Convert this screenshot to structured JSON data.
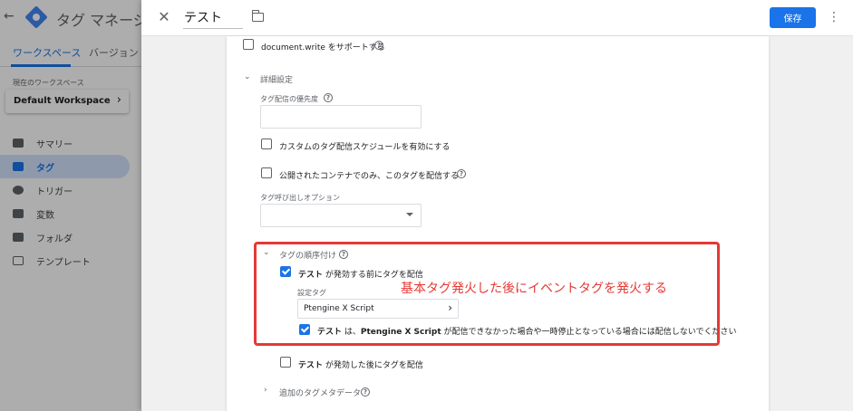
{
  "background": {
    "app_title": "タグ マネージャー",
    "tabs": [
      {
        "label": "ワークスペース",
        "active": true
      },
      {
        "label": "バージョン",
        "active": false
      }
    ],
    "workspace_label": "現在のワークスペース",
    "workspace_name": "Default Workspace",
    "nav_items": [
      {
        "label": "サマリー",
        "icon": "summary-icon",
        "active": false
      },
      {
        "label": "タグ",
        "icon": "tag-icon",
        "active": true
      },
      {
        "label": "トリガー",
        "icon": "trigger-icon",
        "active": false
      },
      {
        "label": "変数",
        "icon": "variable-icon",
        "active": false
      },
      {
        "label": "フォルダ",
        "icon": "folder-icon",
        "active": false
      },
      {
        "label": "テンプレート",
        "icon": "template-icon",
        "active": false
      }
    ]
  },
  "header": {
    "tag_name": "テスト",
    "save_label": "保存"
  },
  "settings": {
    "document_write_label": "document.write をサポートする",
    "advanced_title": "詳細設定",
    "priority_label": "タグ配信の優先度",
    "priority_value": "",
    "schedule_label": "カスタムのタグ配信スケジュールを有効にする",
    "publish_only_label": "公開されたコンテナでのみ、このタグを配信する",
    "firing_option_label": "タグ呼び出しオプション",
    "firing_option_value": "",
    "sequencing": {
      "title": "タグの順序付け",
      "before": {
        "checked": true,
        "tag": "テスト",
        "text": " が発効する前にタグを配信"
      },
      "setup_tag_label": "設定タグ",
      "setup_tag_value": "Ptengine X Script",
      "dont_fire": {
        "checked": true,
        "tag": "テスト",
        "mid": " は、",
        "setup": "Ptengine X Script",
        "text": " が配信できなかった場合や一時停止となっている場合には配信しないでください"
      },
      "after": {
        "checked": false,
        "tag": "テスト",
        "text": " が発効した後にタグを配信"
      }
    },
    "metadata_title": "追加のタグメタデータ"
  },
  "annotation": {
    "text": "基本タグ発火した後にイベントタグを発火する",
    "color": "#e53935"
  },
  "colors": {
    "accent": "#1a73e8",
    "annotation": "#e53935"
  }
}
